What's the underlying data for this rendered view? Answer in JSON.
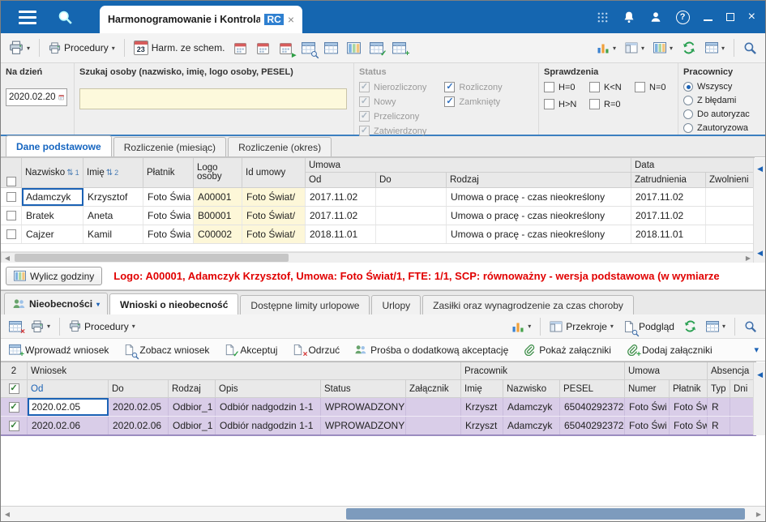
{
  "icons": {
    "chevron_down": "▾",
    "left_arrow": "◀",
    "right_arrow": "▶",
    "check": "✓",
    "plus": "+",
    "x": "×",
    "help": "?",
    "sort": "⇅"
  },
  "titlebar": {
    "tab_title": "Harmonogramowanie i Kontrola",
    "tab_badge": "RC"
  },
  "toolbar": {
    "procedury": "Procedury",
    "cal_day": "23",
    "harm_ze_schem": "Harm. ze schem."
  },
  "filters": {
    "na_dzien_label": "Na dzień",
    "na_dzien_value": "2020.02.20",
    "szukaj_label": "Szukaj osoby (nazwisko, imię, logo osoby, PESEL)",
    "szukaj_value": "",
    "status_label": "Status",
    "status_col1": [
      "Nierozliczony",
      "Nowy",
      "Przeliczony",
      "Zatwierdzony"
    ],
    "status_col2": [
      "Rozliczony",
      "Zamknięty"
    ],
    "sprawdzenia_label": "Sprawdzenia",
    "sprawdzenia_row1": [
      "H=0",
      "K<N",
      "N=0"
    ],
    "sprawdzenia_row2": [
      "H>N",
      "R=0"
    ],
    "pracownicy_label": "Pracownicy",
    "pracownicy_options": [
      "Wszyscy",
      "Z błędami",
      "Do autoryzac",
      "Zautoryzowa"
    ]
  },
  "main_tabs": [
    "Dane podstawowe",
    "Rozliczenie (miesiąc)",
    "Rozliczenie (okres)"
  ],
  "grid": {
    "headers": {
      "nazwisko": "Nazwisko",
      "imie": "Imię",
      "platnik": "Płatnik",
      "logo_osoby": "Logo osoby",
      "id_umowy": "Id umowy",
      "umowa_group": "Umowa",
      "od": "Od",
      "do": "Do",
      "rodzaj": "Rodzaj",
      "data_group": "Data",
      "zatrudnienia": "Zatrudnienia",
      "zwolnienia": "Zwolnieni",
      "sort1": "1",
      "sort2": "2"
    },
    "rows": [
      {
        "nazwisko": "Adamczyk",
        "imie": "Krzysztof",
        "platnik": "Foto Świa",
        "logo_osoby": "A00001",
        "id_umowy": "Foto Świat/",
        "od": "2017.11.02",
        "do": "",
        "rodzaj": "Umowa o pracę - czas nieokreślony",
        "zatrudnienia": "2017.11.02",
        "zwolnienia": ""
      },
      {
        "nazwisko": "Bratek",
        "imie": "Aneta",
        "platnik": "Foto Świa",
        "logo_osoby": "B00001",
        "id_umowy": "Foto Świat/",
        "od": "2017.11.02",
        "do": "",
        "rodzaj": "Umowa o pracę - czas nieokreślony",
        "zatrudnienia": "2017.11.02",
        "zwolnienia": ""
      },
      {
        "nazwisko": "Cajzer",
        "imie": "Kamil",
        "platnik": "Foto Świa",
        "logo_osoby": "C00002",
        "id_umowy": "Foto Świat/",
        "od": "2018.11.01",
        "do": "",
        "rodzaj": "Umowa o pracę - czas nieokreślony",
        "zatrudnienia": "2018.11.01",
        "zwolnienia": ""
      }
    ]
  },
  "calc": {
    "button": "Wylicz godziny",
    "message": "Logo: A00001, Adamczyk Krzysztof, Umowa: Foto Świat/1, FTE: 1/1, SCP: równoważny - wersja podstawowa (w wymiarze"
  },
  "bottom": {
    "section": "Nieobecności",
    "tabs": [
      "Wnioski o nieobecność",
      "Dostępne limity urlopowe",
      "Urlopy",
      "Zasiłki oraz wynagrodzenie za czas choroby"
    ],
    "toolbar": {
      "procedury": "Procedury",
      "przekroje": "Przekroje",
      "podglad": "Podgląd"
    },
    "actions": [
      "Wprowadź wniosek",
      "Zobacz wniosek",
      "Akceptuj",
      "Odrzuć",
      "Prośba o dodatkową akceptację",
      "Pokaż załączniki",
      "Dodaj załączniki"
    ],
    "grid": {
      "count": "2",
      "groups": {
        "wniosek": "Wniosek",
        "pracownik": "Pracownik",
        "umowa": "Umowa",
        "absencja": "Absencja"
      },
      "headers": {
        "od": "Od",
        "do": "Do",
        "rodzaj": "Rodzaj",
        "opis": "Opis",
        "status": "Status",
        "zalacznik": "Załącznik",
        "imie": "Imię",
        "nazwisko": "Nazwisko",
        "pesel": "PESEL",
        "numer": "Numer",
        "platnik": "Płatnik",
        "typ": "Typ",
        "dni": "Dni"
      },
      "rows": [
        {
          "od": "2020.02.05",
          "do": "2020.02.05",
          "rodzaj": "Odbior_1",
          "opis": "Odbiór nadgodzin 1-1",
          "status": "WPROWADZONY",
          "zalacznik": "",
          "imie": "Krzyszt",
          "nazwisko": "Adamczyk",
          "pesel": "65040292372",
          "numer": "Foto Świ",
          "platnik": "Foto Św",
          "typ": "R",
          "dni": ""
        },
        {
          "od": "2020.02.06",
          "do": "2020.02.06",
          "rodzaj": "Odbior_1",
          "opis": "Odbiór nadgodzin 1-1",
          "status": "WPROWADZONY",
          "zalacznik": "",
          "imie": "Krzyszt",
          "nazwisko": "Adamczyk",
          "pesel": "65040292372",
          "numer": "Foto Świ",
          "platnik": "Foto Św",
          "typ": "R",
          "dni": ""
        }
      ]
    }
  }
}
